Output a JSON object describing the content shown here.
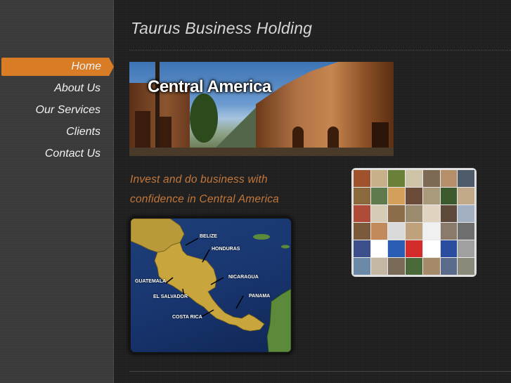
{
  "site": {
    "title": "Taurus Business Holding"
  },
  "nav": {
    "items": [
      {
        "label": "Home",
        "active": true
      },
      {
        "label": "About Us",
        "active": false
      },
      {
        "label": "Our Services",
        "active": false
      },
      {
        "label": "Clients",
        "active": false
      },
      {
        "label": "Contact Us",
        "active": false
      }
    ]
  },
  "banner": {
    "text": "Central America"
  },
  "tagline": "Invest and do business with confidence in Central America",
  "map": {
    "labels": [
      "BELIZE",
      "HONDURAS",
      "GUATEMALA",
      "NICARAGUA",
      "EL SALVADOR",
      "PANAMA",
      "COSTA RICA"
    ]
  },
  "colors": {
    "accent": "#d97c26",
    "tagline": "#c3773a",
    "title": "#d6d6d6",
    "land": "#c9a63d"
  },
  "collage": {
    "tiles": [
      "#a0522d",
      "#c7b08a",
      "#6a7f3a",
      "#cfc3a7",
      "#7c6a55",
      "#b58f6a",
      "#4f5b6a",
      "#8a6a3c",
      "#5f7a4c",
      "#d2a05a",
      "#6b4b3a",
      "#a89a7a",
      "#3c5a2e",
      "#c2a989",
      "#b04b3a",
      "#d6cbb5",
      "#8b6d4a",
      "#9a8b6e",
      "#e0d4c0",
      "#5d4a3a",
      "#a3b0c2",
      "#7a5a3a",
      "#c28a5a",
      "#dadada",
      "#bfa27c",
      "#f0f0f0",
      "#8a7a6a",
      "#6e6e6e",
      "#3c4f8a",
      "#ffffff",
      "#2b5db5",
      "#d42b2b",
      "#ffffff",
      "#2a4da0",
      "#a0a0a0",
      "#6b8aa8",
      "#c4b8a2",
      "#7a6a58",
      "#4a6a3a",
      "#a58a6a",
      "#5a6a8a",
      "#8a8a7a"
    ]
  }
}
